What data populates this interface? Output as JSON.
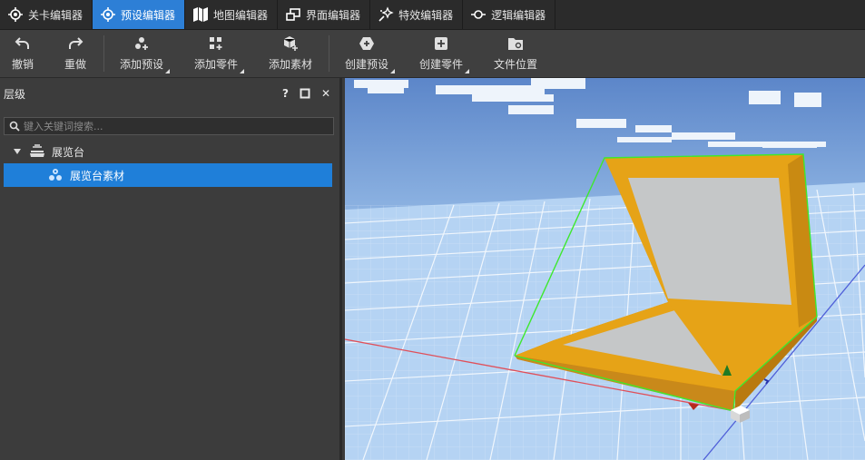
{
  "tabs": [
    {
      "label": "关卡编辑器",
      "icon": "level-target-icon",
      "active": false
    },
    {
      "label": "预设编辑器",
      "icon": "preset-target-icon",
      "active": true
    },
    {
      "label": "地图编辑器",
      "icon": "map-icon",
      "active": false
    },
    {
      "label": "界面编辑器",
      "icon": "ui-windows-icon",
      "active": false
    },
    {
      "label": "特效编辑器",
      "icon": "effect-sparkle-icon",
      "active": false
    },
    {
      "label": "逻辑编辑器",
      "icon": "logic-node-icon",
      "active": false
    }
  ],
  "toolbar": {
    "undo": "撤销",
    "redo": "重做",
    "add_preset": "添加预设",
    "add_part": "添加零件",
    "add_asset": "添加素材",
    "create_preset": "创建预设",
    "create_part": "创建零件",
    "file_location": "文件位置"
  },
  "hierarchy": {
    "title": "层级",
    "help": "?",
    "close": "✕",
    "search_placeholder": "键入关键词搜索...",
    "nodes": [
      {
        "label": "展览台",
        "expanded": true,
        "selected": false,
        "icon": "display-stand-icon"
      },
      {
        "label": "展览台素材",
        "selected": true,
        "icon": "asset-cluster-icon"
      }
    ]
  },
  "colors": {
    "accent": "#2d7fd6",
    "selection": "#1f7fd9",
    "model_frame": "#e6a317",
    "model_panel": "#c5c7c8",
    "selection_outline": "#3ee82e"
  }
}
